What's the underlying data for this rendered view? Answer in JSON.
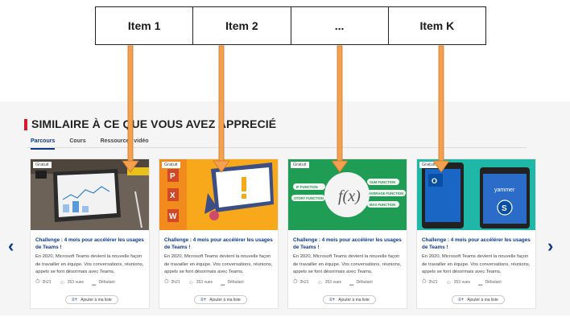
{
  "items": [
    "Item 1",
    "Item 2",
    "...",
    "Item K"
  ],
  "section": {
    "title": "SIMILAIRE À CE QUE VOUS AVEZ APPRECIÉ",
    "tabs": [
      "Parcours",
      "Cours",
      "Ressources vidéo"
    ]
  },
  "cards": [
    {
      "badge": "Gratuit",
      "title": "Challenge : 4 mois pour accélérer les usages de Teams !",
      "desc": "En 2020, Microsoft Teams devient la nouvelle façon de travailler en équipe. Vos conversations, réunions, appels se font désormais avec Teams.",
      "duration": "2h21",
      "views": "353 vues",
      "level": "Débutant",
      "add_label": "Ajouter à ma liste"
    },
    {
      "badge": "Gratuit",
      "title": "Challenge : 4 mois pour accélérer les usages de Teams !",
      "desc": "En 2020, Microsoft Teams devient la nouvelle façon de travailler en équipe. Vos conversations, réunions, appels se font désormais avec Teams.",
      "duration": "2h21",
      "views": "353 vues",
      "level": "Débutant",
      "add_label": "Ajouter à ma liste"
    },
    {
      "badge": "Gratuit",
      "title": "Challenge : 4 mois pour accélérer les usages de Teams !",
      "desc": "En 2020, Microsoft Teams devient la nouvelle façon de travailler en équipe. Vos conversations, réunions, appels se font désormais avec Teams.",
      "duration": "2h21",
      "views": "353 vues",
      "level": "Débutant",
      "add_label": "Ajouter à ma liste"
    },
    {
      "badge": "Gratuit",
      "title": "Challenge : 4 mois pour accélérer les usages de Teams !",
      "desc": "En 2020, Microsoft Teams devient la nouvelle façon de travailler en équipe. Vos conversations, réunions, appels se font désormais avec Teams.",
      "duration": "2h21",
      "views": "353 vues",
      "level": "Débutant",
      "add_label": "Ajouter à ma liste"
    }
  ],
  "thumb_labels": {
    "excel_functions": [
      "IF FUNCTION",
      "STORY FUNCTION",
      "SUM FUNCTION",
      "AVERAGE FUNCTION",
      "MAX FUNCTION"
    ],
    "fx": "f(x)",
    "yammer": "yammer"
  },
  "icons": {
    "prev": "chevron-left-icon",
    "next": "chevron-right-icon",
    "duration": "stopwatch-icon",
    "views": "users-icon",
    "level": "signal-icon",
    "add": "playlist-add-icon"
  },
  "colors": {
    "accent": "#d91b2d",
    "link": "#0b3a8a",
    "arrow": "#f5a04e"
  }
}
